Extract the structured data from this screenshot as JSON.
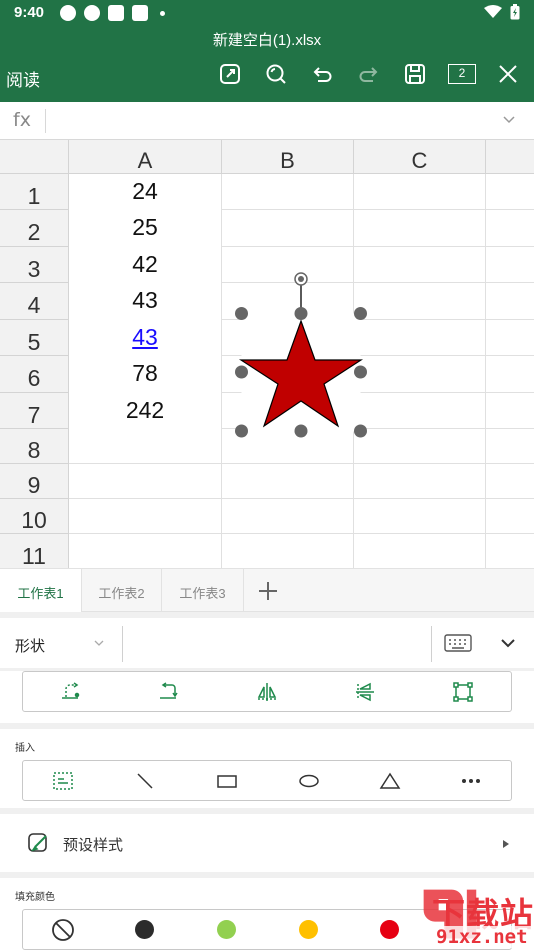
{
  "status_bar": {
    "time": "9:40"
  },
  "title_bar": {
    "document_title": "新建空白(1).xlsx",
    "mode_label": "阅读",
    "sheet_count": "2"
  },
  "formula_bar": {
    "fx_label": "fx",
    "value": ""
  },
  "grid": {
    "columns": [
      "A",
      "B",
      "C"
    ],
    "rows": [
      "1",
      "2",
      "3",
      "4",
      "5",
      "6",
      "7",
      "8",
      "9",
      "10",
      "11"
    ],
    "column_a_values": [
      "24",
      "25",
      "42",
      "43",
      "43",
      "78",
      "242"
    ]
  },
  "shape": {
    "type": "star",
    "fill_color": "#c00000",
    "outline_color": "#000000"
  },
  "sheet_tabs": [
    "工作表1",
    "工作表2",
    "工作表3"
  ],
  "tool_panel": {
    "category_label": "形状",
    "insert_label": "插入",
    "preset_style_label": "预设样式",
    "fill_color_label": "填充颜色",
    "fill_colors": [
      "#2b2b2b",
      "#92d050",
      "#ffc000",
      "#e60012"
    ]
  },
  "watermark": {
    "brand_text": "下载站",
    "url_text": "91xz.net"
  },
  "colors": {
    "accent": "#217346",
    "link": "#1a0dff"
  }
}
